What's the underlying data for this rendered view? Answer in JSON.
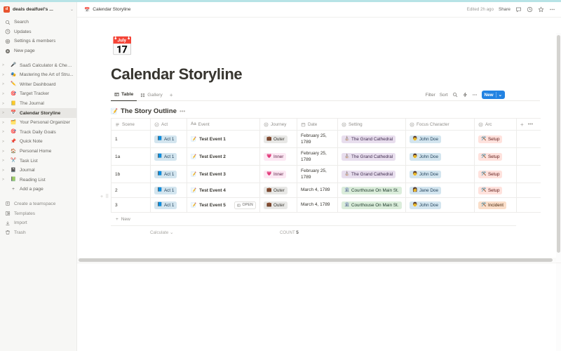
{
  "sidebar": {
    "workspace": {
      "initial": "d",
      "name": "deals dealfuel's ...",
      "caret": "⌄"
    },
    "quick_items": [
      {
        "label": "Search",
        "icon": "search-icon"
      },
      {
        "label": "Updates",
        "icon": "clock-icon"
      },
      {
        "label": "Settings & members",
        "icon": "gear-icon"
      },
      {
        "label": "New page",
        "icon": "new-page-icon"
      }
    ],
    "pages": [
      {
        "label": "SaaS Calculator & Cheat ...",
        "emoji": "🎤",
        "selected": false
      },
      {
        "label": "Mastering the Art of Stru...",
        "emoji": "🎭",
        "selected": false
      },
      {
        "label": "Writer Dashboard",
        "emoji": "✏️",
        "selected": false
      },
      {
        "label": "Target Tracker",
        "emoji": "🎯",
        "selected": false
      },
      {
        "label": "The Journal",
        "emoji": "📒",
        "selected": false
      },
      {
        "label": "Calendar Storyline",
        "emoji": "📅",
        "selected": true
      },
      {
        "label": "Your Personal Organizer",
        "emoji": "🗂️",
        "selected": false
      },
      {
        "label": "Track Daily Goals",
        "emoji": "🎯",
        "selected": false
      },
      {
        "label": "Quick Note",
        "emoji": "📌",
        "selected": false
      },
      {
        "label": "Personal Home",
        "emoji": "🏠",
        "selected": false
      },
      {
        "label": "Task List",
        "emoji": "✂️",
        "selected": false
      },
      {
        "label": "Journal",
        "emoji": "📓",
        "selected": false
      },
      {
        "label": "Reading List",
        "emoji": "📗",
        "selected": false
      }
    ],
    "add_page_label": "Add a page",
    "bottom_items": [
      {
        "label": "Create a teamspace",
        "icon": "teamspace-icon"
      },
      {
        "label": "Templates",
        "icon": "templates-icon"
      },
      {
        "label": "Import",
        "icon": "import-icon"
      },
      {
        "label": "Trash",
        "icon": "trash-icon"
      }
    ]
  },
  "topbar": {
    "breadcrumb": "Calendar Storyline",
    "breadcrumb_emoji": "📅",
    "edited": "Edited 2h ago",
    "share": "Share",
    "icons": [
      "comment-icon",
      "history-icon",
      "star-icon",
      "more-horizontal-icon"
    ]
  },
  "page": {
    "cover_emoji": "📅",
    "title": "Calendar Storyline"
  },
  "views": {
    "tabs": [
      {
        "label": "Table",
        "icon": "table-icon",
        "active": true
      },
      {
        "label": "Gallery",
        "icon": "gallery-icon",
        "active": false
      }
    ],
    "add_view": "+",
    "toolbar": {
      "filter": "Filter",
      "sort": "Sort",
      "search_icon": "search-icon",
      "automation_icon": "lightning-icon",
      "more_icon": "more-horizontal-icon",
      "new_label": "New",
      "new_caret": "⌄"
    }
  },
  "database": {
    "title": "The Story Outline",
    "title_emoji": "📝",
    "title_more": "•••",
    "columns": [
      {
        "label": "Scene",
        "icon": "lines-icon"
      },
      {
        "label": "Act",
        "icon": "select-icon"
      },
      {
        "label": "Event",
        "icon": "title-aa-icon"
      },
      {
        "label": "Journey",
        "icon": "select-icon"
      },
      {
        "label": "Date",
        "icon": "calendar-icon"
      },
      {
        "label": "Setting",
        "icon": "select-icon"
      },
      {
        "label": "Focus Character",
        "icon": "select-icon"
      },
      {
        "label": "Arc",
        "icon": "select-icon"
      }
    ],
    "add_column": "+",
    "column_options": "•••",
    "rows": [
      {
        "scene": "1",
        "act": {
          "text": "Act 1",
          "emoji": "📘",
          "bg": "#d3e5ef",
          "fg": "#1d3d57"
        },
        "event": {
          "text": "Test Event 1",
          "emoji": "📝",
          "open": false
        },
        "journey": {
          "text": "Outer",
          "emoji": "💼",
          "bg": "#e8e8e6",
          "fg": "#37352f"
        },
        "date": "February 25, 1789",
        "setting": {
          "text": "The Grand Cathedral",
          "emoji": "⛪",
          "bg": "#e8deee",
          "fg": "#3f2b4e"
        },
        "character": {
          "text": "John Doe",
          "emoji": "👨",
          "bg": "#d3e5ef",
          "fg": "#1d3d57"
        },
        "arc": {
          "text": "Setup",
          "emoji": "🛠️",
          "bg": "#ffe2dd",
          "fg": "#5d1715"
        }
      },
      {
        "scene": "1a",
        "act": {
          "text": "Act 1",
          "emoji": "📘",
          "bg": "#d3e5ef",
          "fg": "#1d3d57"
        },
        "event": {
          "text": "Test Event 2",
          "emoji": "📝",
          "open": false
        },
        "journey": {
          "text": "Inner",
          "emoji": "💗",
          "bg": "#fce8f3",
          "fg": "#5c1d43"
        },
        "date": "February 25, 1789",
        "setting": {
          "text": "The Grand Cathedral",
          "emoji": "⛪",
          "bg": "#e8deee",
          "fg": "#3f2b4e"
        },
        "character": {
          "text": "John Doe",
          "emoji": "👨",
          "bg": "#d3e5ef",
          "fg": "#1d3d57"
        },
        "arc": {
          "text": "Setup",
          "emoji": "🛠️",
          "bg": "#ffe2dd",
          "fg": "#5d1715"
        }
      },
      {
        "scene": "1b",
        "act": {
          "text": "Act 1",
          "emoji": "📘",
          "bg": "#d3e5ef",
          "fg": "#1d3d57"
        },
        "event": {
          "text": "Test Event 3",
          "emoji": "📝",
          "open": false
        },
        "journey": {
          "text": "Inner",
          "emoji": "💗",
          "bg": "#fce8f3",
          "fg": "#5c1d43"
        },
        "date": "February 25, 1789",
        "setting": {
          "text": "The Grand Cathedral",
          "emoji": "⛪",
          "bg": "#e8deee",
          "fg": "#3f2b4e"
        },
        "character": {
          "text": "John Doe",
          "emoji": "👨",
          "bg": "#d3e5ef",
          "fg": "#1d3d57"
        },
        "arc": {
          "text": "Setup",
          "emoji": "🛠️",
          "bg": "#ffe2dd",
          "fg": "#5d1715"
        }
      },
      {
        "scene": "2",
        "act": {
          "text": "Act 1",
          "emoji": "📘",
          "bg": "#d3e5ef",
          "fg": "#1d3d57"
        },
        "event": {
          "text": "Test Event 4",
          "emoji": "📝",
          "open": false
        },
        "journey": {
          "text": "Outer",
          "emoji": "💼",
          "bg": "#e8e8e6",
          "fg": "#37352f"
        },
        "date": "March 4, 1789",
        "setting": {
          "text": "Courthouse On Main St.",
          "emoji": "🏛️",
          "bg": "#dbeddb",
          "fg": "#1c3829"
        },
        "character": {
          "text": "Jane Doe",
          "emoji": "👩",
          "bg": "#d3e5ef",
          "fg": "#1d3d57"
        },
        "arc": {
          "text": "Setup",
          "emoji": "🛠️",
          "bg": "#ffe2dd",
          "fg": "#5d1715"
        }
      },
      {
        "scene": "3",
        "act": {
          "text": "Act 1",
          "emoji": "📘",
          "bg": "#d3e5ef",
          "fg": "#1d3d57"
        },
        "event": {
          "text": "Test Event 5",
          "emoji": "📝",
          "open": true,
          "open_label": "OPEN"
        },
        "journey": {
          "text": "Outer",
          "emoji": "💼",
          "bg": "#e8e8e6",
          "fg": "#37352f"
        },
        "date": "March 4, 1789",
        "setting": {
          "text": "Courthouse On Main St.",
          "emoji": "🏛️",
          "bg": "#dbeddb",
          "fg": "#1c3829"
        },
        "character": {
          "text": "John Doe",
          "emoji": "👨",
          "bg": "#d3e5ef",
          "fg": "#1d3d57"
        },
        "arc": {
          "text": "Incident",
          "emoji": "🛠️",
          "bg": "#fadec9",
          "fg": "#49290e"
        }
      }
    ],
    "new_row_label": "New",
    "footer": {
      "calculate_label": "Calculate",
      "calculate_caret": "⌄",
      "count_label": "COUNT",
      "count_value": "5"
    }
  }
}
